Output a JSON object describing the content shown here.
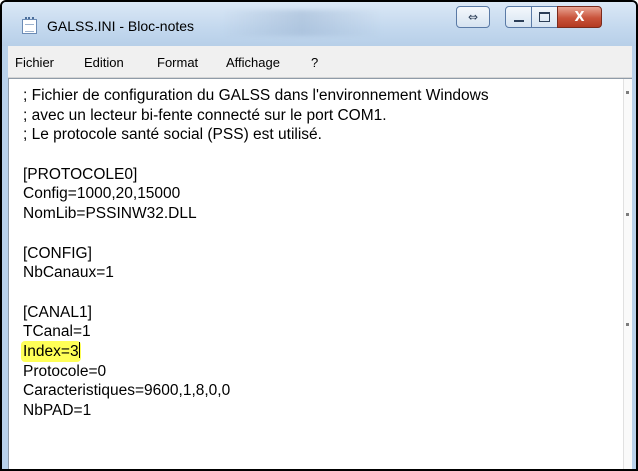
{
  "window": {
    "title": "GALSS.INI - Bloc-notes",
    "close_glyph": "X"
  },
  "menu": {
    "items": [
      "Fichier",
      "Edition",
      "Format",
      "Affichage",
      "?"
    ]
  },
  "editor": {
    "lines": [
      "; Fichier de configuration du GALSS dans l'environnement Windows",
      "; avec un lecteur bi-fente connecté sur le port COM1.",
      "; Le protocole santé social (PSS) est utilisé.",
      "",
      "[PROTOCOLE0]",
      "Config=1000,20,15000",
      "NomLib=PSSINW32.DLL",
      "",
      "[CONFIG]",
      "NbCanaux=1",
      "",
      "[CANAL1]",
      "TCanal=1",
      "Index=3",
      "Protocole=0",
      "Caracteristiques=9600,1,8,0,0",
      "NbPAD=1"
    ],
    "highlighted_line": "Index=3",
    "highlight_color": "#ffff57"
  },
  "icons": {
    "app": "notepad-icon",
    "swap": "swap-arrows-icon",
    "minimize": "minimize-icon",
    "maximize": "maximize-icon",
    "close": "close-icon"
  },
  "colors": {
    "titlebar": "#c3d8ee",
    "close_button": "#c9533b",
    "menubar": "#f0f0f0"
  }
}
